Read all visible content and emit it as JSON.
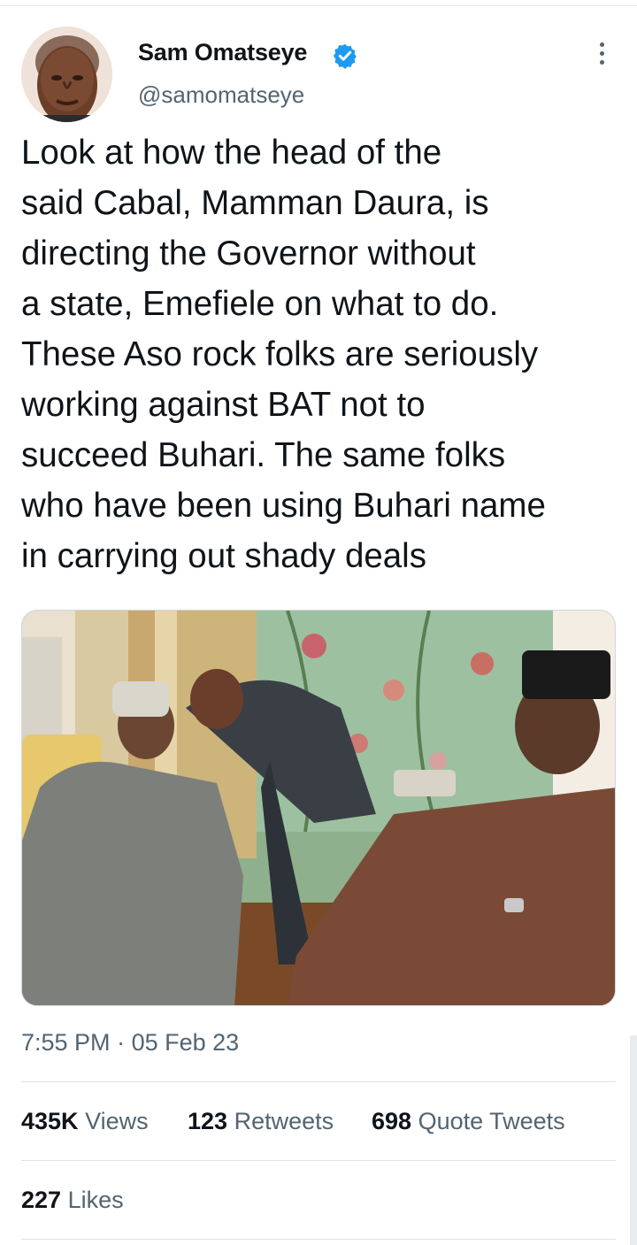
{
  "tweet": {
    "author_name": "Sam Omatseye",
    "handle": "@samomatseye",
    "verified": true,
    "text_lines": [
      "Look at how the head of the",
      "said Cabal, Mamman Daura, is",
      "directing the Governor without",
      "a state, Emefiele on what to do.",
      "These Aso rock folks are seriously",
      "working against BAT not to",
      "succeed Buhari. The same folks",
      "who have been using Buhari name",
      "in carrying out shady deals"
    ],
    "time": "7:55 PM",
    "date": "05 Feb 23",
    "separator": "·"
  },
  "stats": {
    "views_count": "435K",
    "views_label": "Views",
    "retweets_count": "123",
    "retweets_label": "Retweets",
    "quotes_count": "698",
    "quotes_label": "Quote Tweets",
    "likes_count": "227",
    "likes_label": "Likes"
  },
  "icons": {
    "verified": "verified-badge-icon",
    "more": "more-options-icon"
  },
  "colors": {
    "text": "#0f1419",
    "secondary": "#536471",
    "verified_blue": "#1d9bf0",
    "divider": "#dfe3e7"
  }
}
